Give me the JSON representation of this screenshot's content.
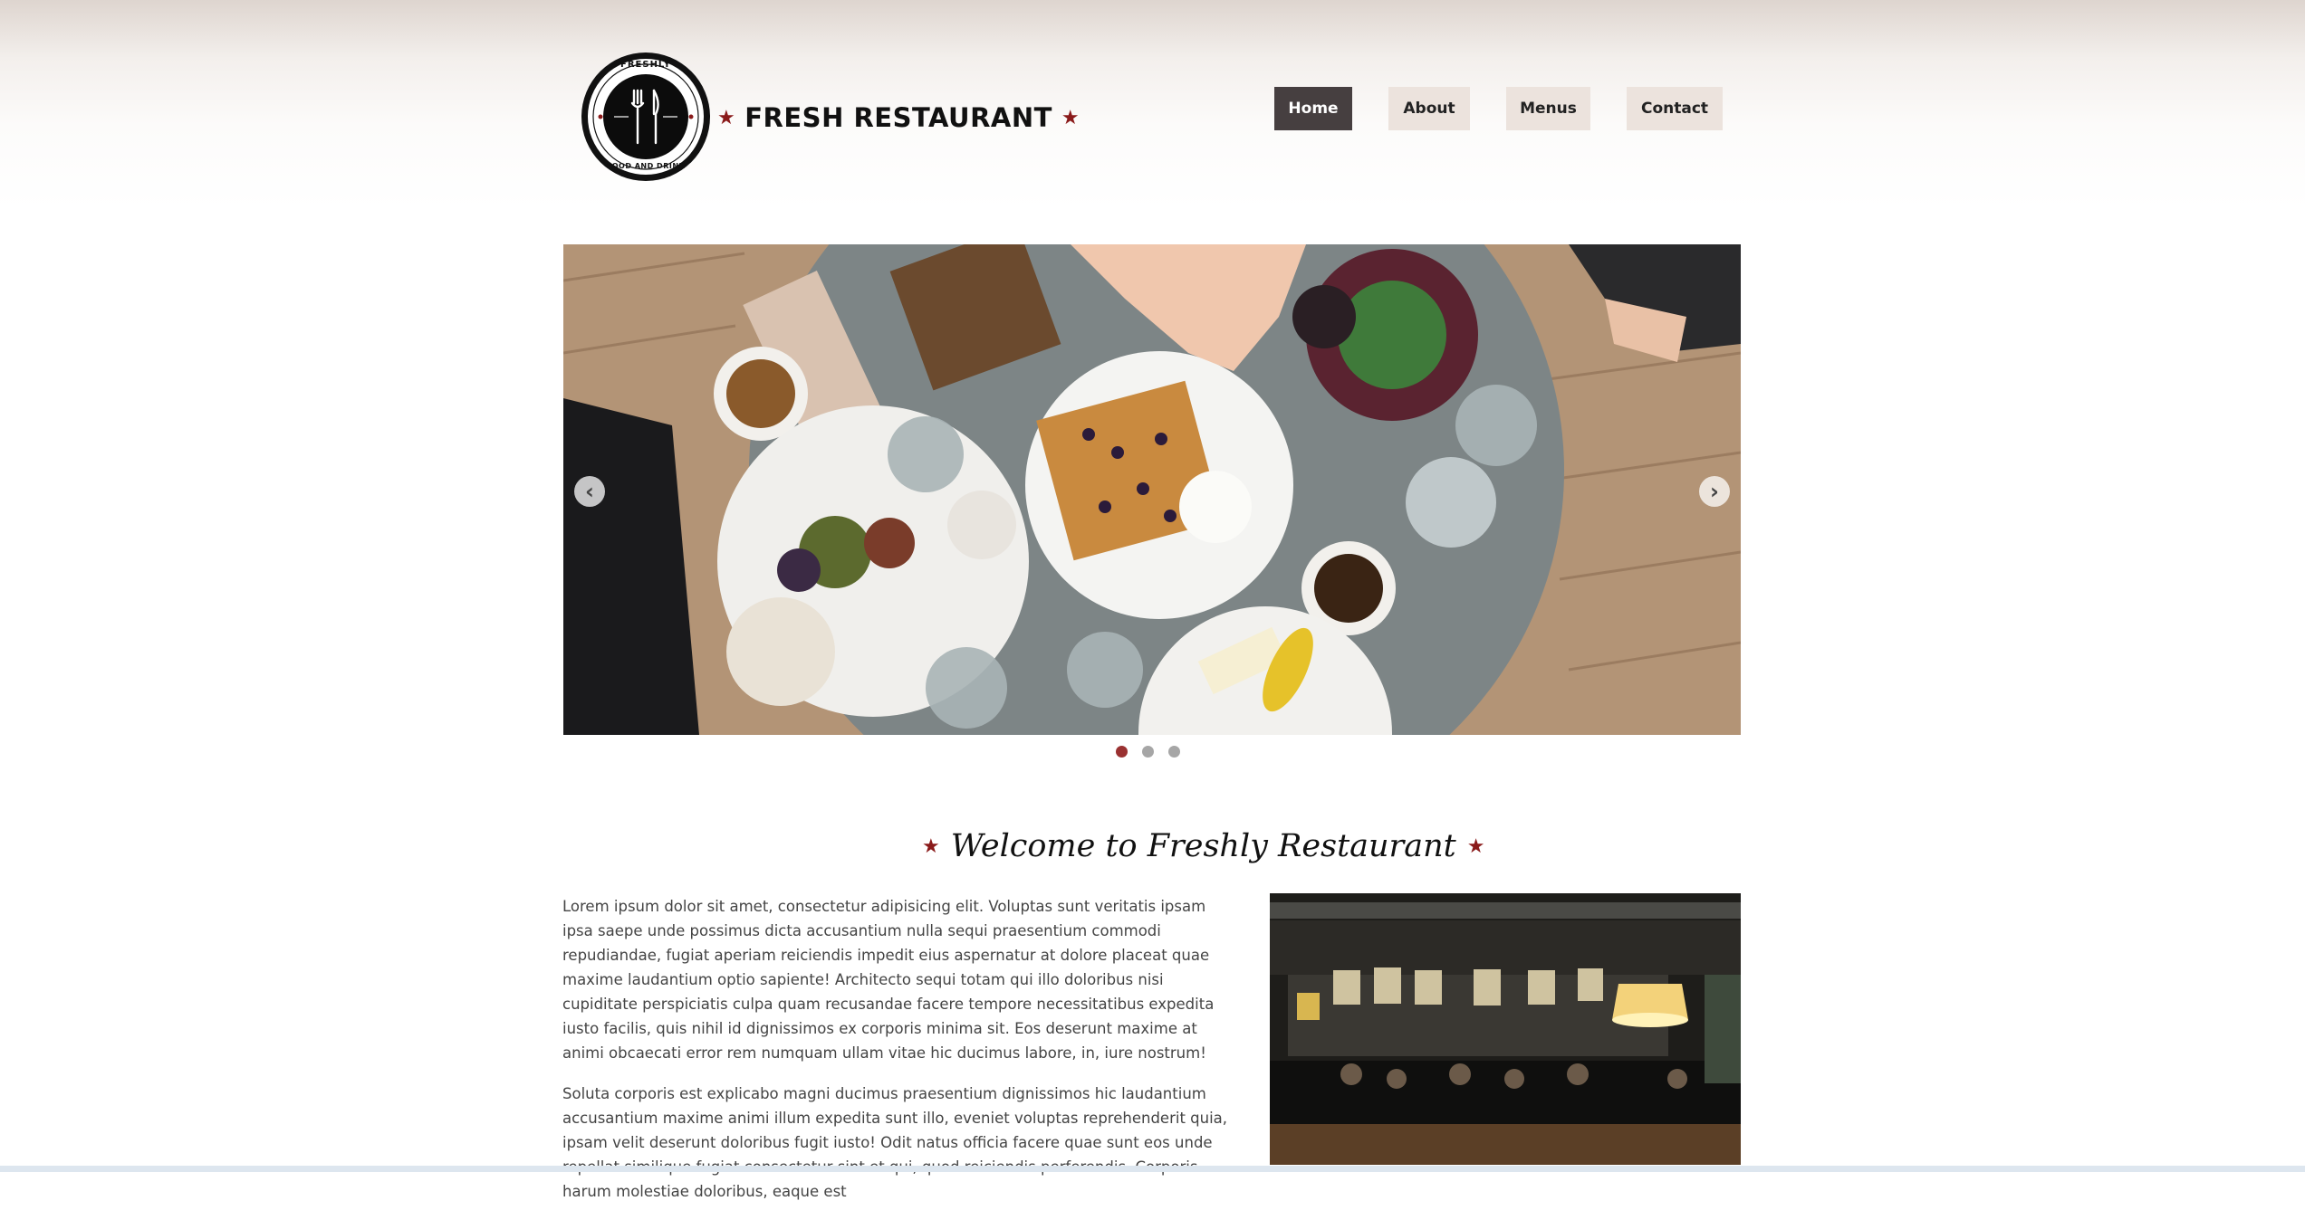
{
  "brand": {
    "logo_top_text": "FRESHLY",
    "logo_bottom_text": "FOOD AND DRINK",
    "name": "FRESH RESTAURANT",
    "accent_color": "#8a1a1a"
  },
  "nav": {
    "items": [
      {
        "label": "Home",
        "active": true
      },
      {
        "label": "About",
        "active": false
      },
      {
        "label": "Menus",
        "active": false
      },
      {
        "label": "Contact",
        "active": false
      }
    ],
    "active_color": "#463f40",
    "inactive_color": "#ece3dd"
  },
  "slider": {
    "prev_icon": "chevron-left-icon",
    "next_icon": "chevron-right-icon",
    "slide_count": 3,
    "active_index": 0,
    "image_alt": "Overhead view of a restaurant table with waffles, coffee and plates"
  },
  "welcome": {
    "title": "Welcome to Freshly Restaurant",
    "paragraphs": [
      "Lorem ipsum dolor sit amet, consectetur adipisicing elit. Voluptas sunt veritatis ipsam ipsa saepe unde possimus dicta accusantium nulla sequi praesentium commodi repudiandae, fugiat aperiam reiciendis impedit eius aspernatur at dolore placeat quae maxime laudantium optio sapiente! Architecto sequi totam qui illo doloribus nisi cupiditate perspiciatis culpa quam recusandae facere tempore necessitatibus expedita iusto facilis, quis nihil id dignissimos ex corporis minima sit. Eos deserunt maxime at animi obcaecati error rem numquam ullam vitae hic ducimus labore, in, iure nostrum!",
      "Soluta corporis est explicabo magni ducimus praesentium dignissimos hic laudantium accusantium maxime animi illum expedita sunt illo, eveniet voluptas reprehenderit quia, ipsam velit deserunt doloribus fugit iusto! Odit natus officia facere quae sunt eos unde repellat similique fugiat consectetur sint et qui, quod reiciendis perferendis. Corporis harum molestiae doloribus, eaque est"
    ]
  }
}
